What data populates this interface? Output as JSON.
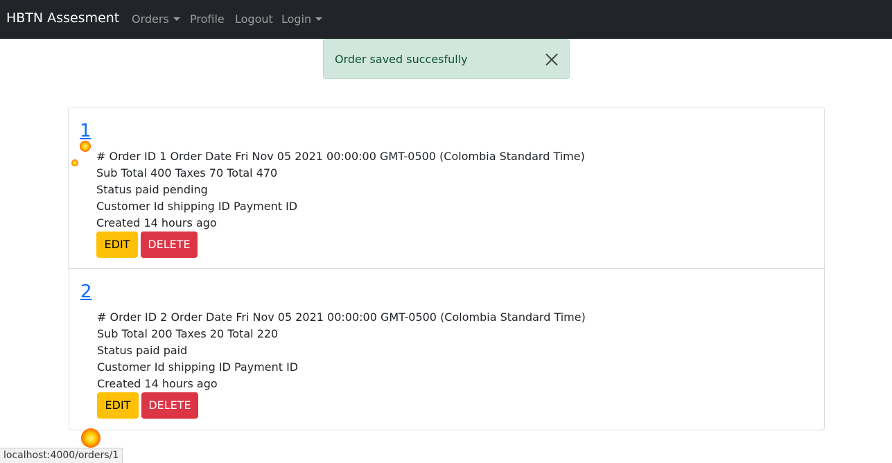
{
  "navbar": {
    "brand": "HBTN Assesment",
    "links": [
      {
        "label": "Orders",
        "dropdown": true
      },
      {
        "label": "Profile",
        "dropdown": false
      },
      {
        "label": "Logout",
        "dropdown": false
      },
      {
        "label": "Login",
        "dropdown": true
      }
    ]
  },
  "alert": {
    "message": "Order saved succesfully",
    "close_icon": "close-icon"
  },
  "orders": [
    {
      "number": "1",
      "line1": "# Order ID 1 Order Date Fri Nov 05 2021 00:00:00 GMT-0500 (Colombia Standard Time)",
      "line2": "Sub Total 400 Taxes 70 Total 470",
      "line3": "Status paid pending",
      "line4": "Customer Id shipping ID Payment ID",
      "line5": "Created 14 hours ago",
      "edit_label": "EDIT",
      "delete_label": "DELETE"
    },
    {
      "number": "2",
      "line1": "# Order ID 2 Order Date Fri Nov 05 2021 00:00:00 GMT-0500 (Colombia Standard Time)",
      "line2": "Sub Total 200 Taxes 20 Total 220",
      "line3": "Status paid paid",
      "line4": "Customer Id shipping ID Payment ID",
      "line5": "Created 14 hours ago",
      "edit_label": "EDIT",
      "delete_label": "DELETE"
    }
  ],
  "status_bar": {
    "url": "localhost:4000/orders/1"
  },
  "colors": {
    "navbar_bg": "#212529",
    "alert_bg": "#d1e7dd",
    "alert_text": "#0f5132",
    "link": "#0d6efd",
    "edit_button": "#ffc107",
    "delete_button": "#dc3545"
  }
}
